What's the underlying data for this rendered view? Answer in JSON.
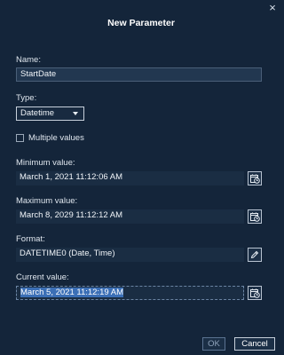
{
  "dialog": {
    "title": "New Parameter",
    "close_glyph": "×"
  },
  "name": {
    "label": "Name:",
    "value": "StartDate"
  },
  "type": {
    "label": "Type:",
    "selected": "Datetime"
  },
  "multiple_values": {
    "label": "Multiple values",
    "checked": false
  },
  "minimum": {
    "label": "Minimum value:",
    "value": "March 1, 2021 11:12:06 AM",
    "icon": "calendar-clock-icon"
  },
  "maximum": {
    "label": "Maximum value:",
    "value": "March 8, 2029 11:12:12 AM",
    "icon": "calendar-clock-icon"
  },
  "format": {
    "label": "Format:",
    "value": "DATETIME0 (Date, Time)",
    "icon": "pencil-icon"
  },
  "current": {
    "label": "Current value:",
    "value": "March 5, 2021 11:12:19 AM",
    "icon": "calendar-clock-icon"
  },
  "buttons": {
    "ok": "OK",
    "cancel": "Cancel"
  }
}
